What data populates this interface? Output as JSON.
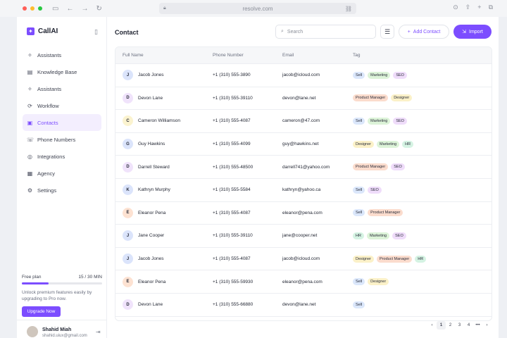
{
  "browser": {
    "url": "resolve.com"
  },
  "brand": {
    "name": "CallAI"
  },
  "menu": [
    {
      "label": "Assistants",
      "icon": "sparkle-icon",
      "glyph": "✧"
    },
    {
      "label": "Knowledge Base",
      "icon": "book-icon",
      "glyph": "▤"
    },
    {
      "label": "Assistants",
      "icon": "sparkle-icon",
      "glyph": "✧"
    },
    {
      "label": "Workflow",
      "icon": "workflow-icon",
      "glyph": "⟳"
    },
    {
      "label": "Contacts",
      "icon": "contacts-icon",
      "glyph": "▣",
      "active": true
    },
    {
      "label": "Phone Numbers",
      "icon": "phone-icon",
      "glyph": "☏"
    },
    {
      "label": "Integrations",
      "icon": "integrations-icon",
      "glyph": "◎"
    },
    {
      "label": "Agency",
      "icon": "agency-icon",
      "glyph": "▦"
    },
    {
      "label": "Settings",
      "icon": "gear-icon",
      "glyph": "⚙"
    }
  ],
  "plan": {
    "name": "Free plan",
    "usage": "15 / 30 MIN",
    "progress": 0.33,
    "description": "Unlock premium features easily by upgrading to Pro now.",
    "upgrade_label": "Upgrade Now"
  },
  "profile": {
    "name": "Shahid Miah",
    "email": "shahid.uiux@gmail.com"
  },
  "header": {
    "title": "Contact",
    "search_placeholder": "Search",
    "add_label": "Add Contact",
    "import_label": "Import"
  },
  "table": {
    "columns": [
      "Full Name",
      "Phone Number",
      "Email",
      "Tag"
    ],
    "rows": [
      {
        "initial": "J",
        "name": "Jacob Jones",
        "phone": "+1 (310) 555-3890",
        "email": "jacob@icloud.com",
        "tags": [
          "Sell",
          "Marketing",
          "SEO"
        ]
      },
      {
        "initial": "D",
        "name": "Devon Lane",
        "phone": "+1 (310) 555-39110",
        "email": "devon@lane.net",
        "tags": [
          "Product Manager",
          "Designer"
        ]
      },
      {
        "initial": "C",
        "name": "Cameron Williamson",
        "phone": "+1 (310) 555-4087",
        "email": "cameron@47.com",
        "tags": [
          "Sell",
          "Marketing",
          "SEO"
        ]
      },
      {
        "initial": "G",
        "name": "Guy Hawkins",
        "phone": "+1 (310) 555-4099",
        "email": "guy@hawkins.net",
        "tags": [
          "Designer",
          "Marketing",
          "HR"
        ]
      },
      {
        "initial": "D",
        "name": "Darrell Steward",
        "phone": "+1 (310) 555-48500",
        "email": "darrell741@yahoo.com",
        "tags": [
          "Product Manager",
          "SEO"
        ]
      },
      {
        "initial": "K",
        "name": "Kathryn Murphy",
        "phone": "+1 (310) 555-5584",
        "email": "kathryn@yahoo.ca",
        "tags": [
          "Sell",
          "SEO"
        ]
      },
      {
        "initial": "E",
        "name": "Eleanor Pena",
        "phone": "+1 (310) 555-4087",
        "email": "eleanor@pena.com",
        "tags": [
          "Sell",
          "Product Manager"
        ]
      },
      {
        "initial": "J",
        "name": "Jane Cooper",
        "phone": "+1 (310) 555-39110",
        "email": "jane@cooper.net",
        "tags": [
          "HR",
          "Marketing",
          "SEO"
        ]
      },
      {
        "initial": "J",
        "name": "Jacob Jones",
        "phone": "+1 (310) 555-4087",
        "email": "jacob@icloud.com",
        "tags": [
          "Designer",
          "Product Manager",
          "HR"
        ]
      },
      {
        "initial": "E",
        "name": "Eleanor Pena",
        "phone": "+1 (310) 555-59930",
        "email": "eleanor@pena.com",
        "tags": [
          "Sell",
          "Designer"
        ]
      },
      {
        "initial": "D",
        "name": "Devon Lane",
        "phone": "+1 (310) 555-66880",
        "email": "devon@lane.net",
        "tags": [
          "Sell"
        ]
      }
    ]
  },
  "pagination": {
    "pages": [
      "1",
      "2",
      "3",
      "4",
      "•••"
    ],
    "current": "1"
  },
  "colors": {
    "accent": "#7c4dff",
    "avatar_J": "#dbe4fb",
    "avatar_D": "#f0e3fb",
    "avatar_C": "#fbf3cf",
    "avatar_G": "#dbe4fb",
    "avatar_K": "#dbe4fb",
    "avatar_E": "#fde2d2",
    "tag_Sell": "#dbe7fb",
    "tag_Marketing": "#dcf3d8",
    "tag_SEO": "#efdcfa",
    "tag_Product Manager": "#fbdccd",
    "tag_Designer": "#fbf1c8",
    "tag_HR": "#d5f3e3"
  }
}
